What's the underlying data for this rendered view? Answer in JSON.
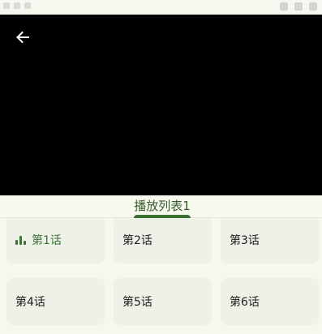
{
  "tabs": [
    {
      "label": "播放列表1",
      "selected": true
    }
  ],
  "episodes": [
    {
      "label": "第1话",
      "playing": true
    },
    {
      "label": "第2话",
      "playing": false
    },
    {
      "label": "第3话",
      "playing": false
    },
    {
      "label": "第4话",
      "playing": false
    },
    {
      "label": "第5话",
      "playing": false
    },
    {
      "label": "第6话",
      "playing": false
    }
  ],
  "icons": {
    "back": "back-arrow-icon",
    "playing": "equalizer-bars-icon"
  },
  "colors": {
    "background": "#f6f8f0",
    "video": "#000000",
    "accent": "#3a6f31",
    "card": "#eef1e8"
  }
}
